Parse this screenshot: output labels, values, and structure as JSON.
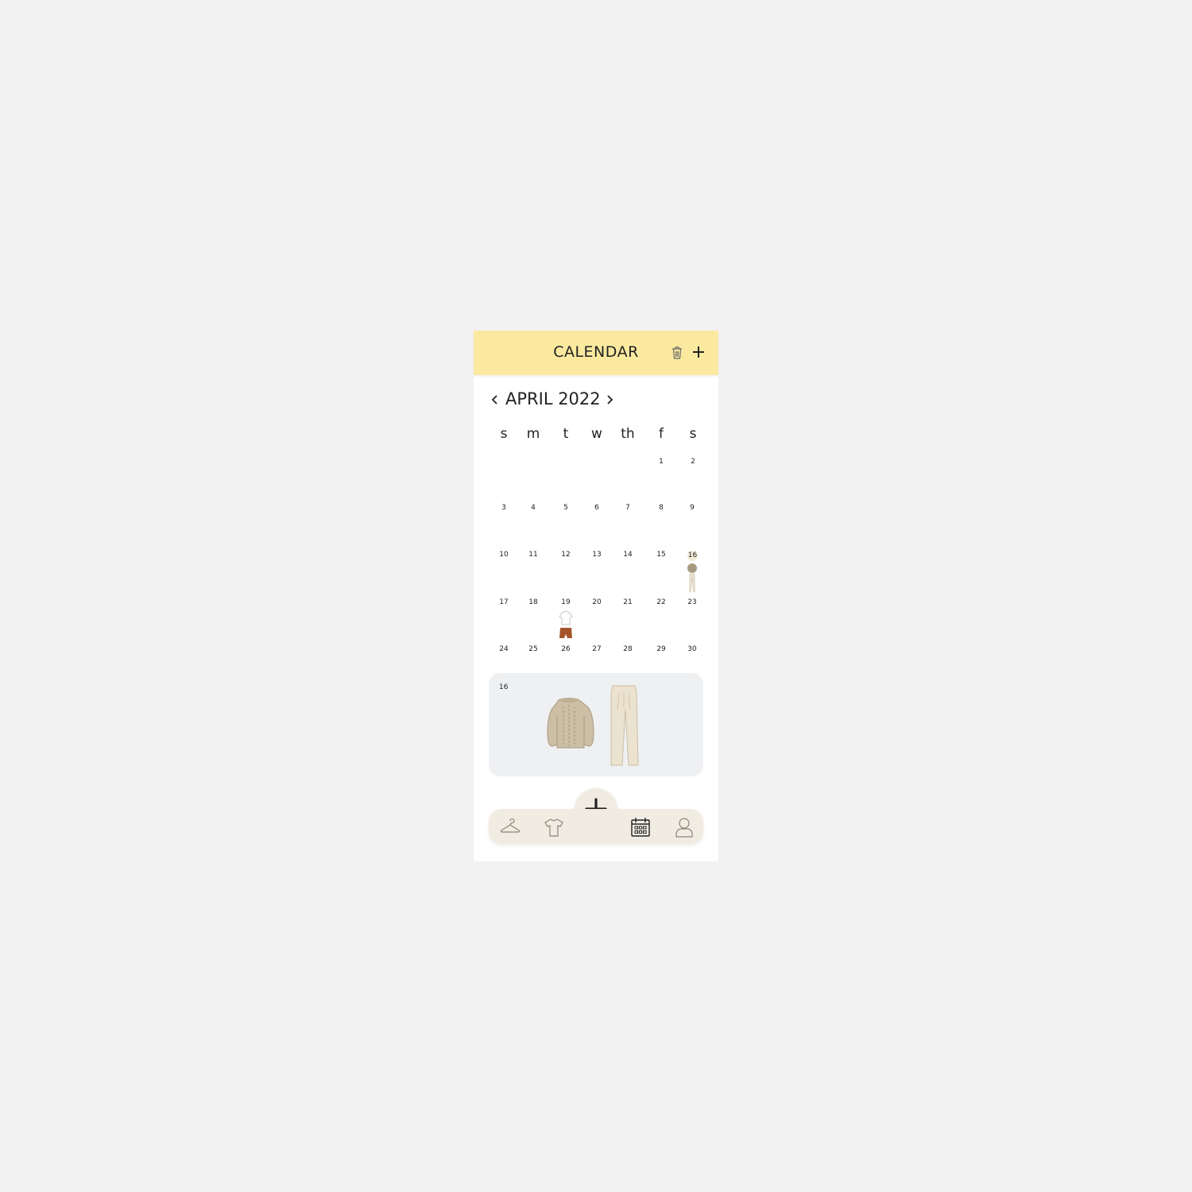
{
  "header": {
    "title": "CALENDAR"
  },
  "calendar": {
    "month_label": "APRIL 2022",
    "weekdays": [
      "s",
      "m",
      "t",
      "w",
      "th",
      "f",
      "s"
    ],
    "rows": [
      [
        "",
        "",
        "",
        "",
        "",
        "1",
        "2"
      ],
      [
        "3",
        "4",
        "5",
        "6",
        "7",
        "8",
        "9"
      ],
      [
        "10",
        "11",
        "12",
        "13",
        "14",
        "15",
        "16"
      ],
      [
        "17",
        "18",
        "19",
        "20",
        "21",
        "22",
        "23"
      ],
      [
        "24",
        "25",
        "26",
        "27",
        "28",
        "29",
        "30"
      ]
    ],
    "selected_day": "16",
    "days_with_outfits": [
      "16",
      "19"
    ]
  },
  "detail": {
    "day": "16",
    "items": [
      "sweater",
      "trousers"
    ]
  },
  "colors": {
    "header_bg": "#fbe99f",
    "nav_bg": "#f1ece2",
    "detail_bg": "#eff0f2",
    "text": "#222222",
    "icon_muted": "#8a8478"
  },
  "nav": {
    "items": [
      "hanger-icon",
      "tshirt-icon",
      "add-icon",
      "calendar-icon",
      "user-icon"
    ],
    "active": "calendar-icon"
  }
}
